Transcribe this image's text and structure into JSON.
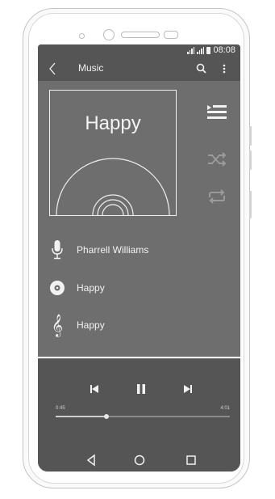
{
  "status_bar": {
    "time": "08:08",
    "icons": [
      "signal-icon",
      "signal-icon",
      "battery-icon"
    ]
  },
  "app_bar": {
    "title": "Music",
    "icons": [
      "back-arrow-icon",
      "search-icon",
      "more-vert-icon"
    ]
  },
  "album": {
    "title": "Happy"
  },
  "side_actions": [
    "playlist-icon",
    "shuffle-icon",
    "repeat-icon"
  ],
  "track_info": [
    {
      "icon": "microphone-icon",
      "label": "Pharrell Williams"
    },
    {
      "icon": "disc-icon",
      "label": "Happy"
    },
    {
      "icon": "treble-clef-icon",
      "label": "Happy"
    }
  ],
  "player": {
    "controls": [
      "skip-previous-icon",
      "pause-icon",
      "skip-next-icon"
    ],
    "elapsed": "0:45",
    "duration": "4:01",
    "progress": 0.29
  },
  "nav_bar": [
    "nav-back-icon",
    "nav-home-icon",
    "nav-recents-icon"
  ],
  "colors": {
    "screen": "#6e6e6e",
    "bars": "#555555",
    "foreground": "#f2f2f2"
  }
}
